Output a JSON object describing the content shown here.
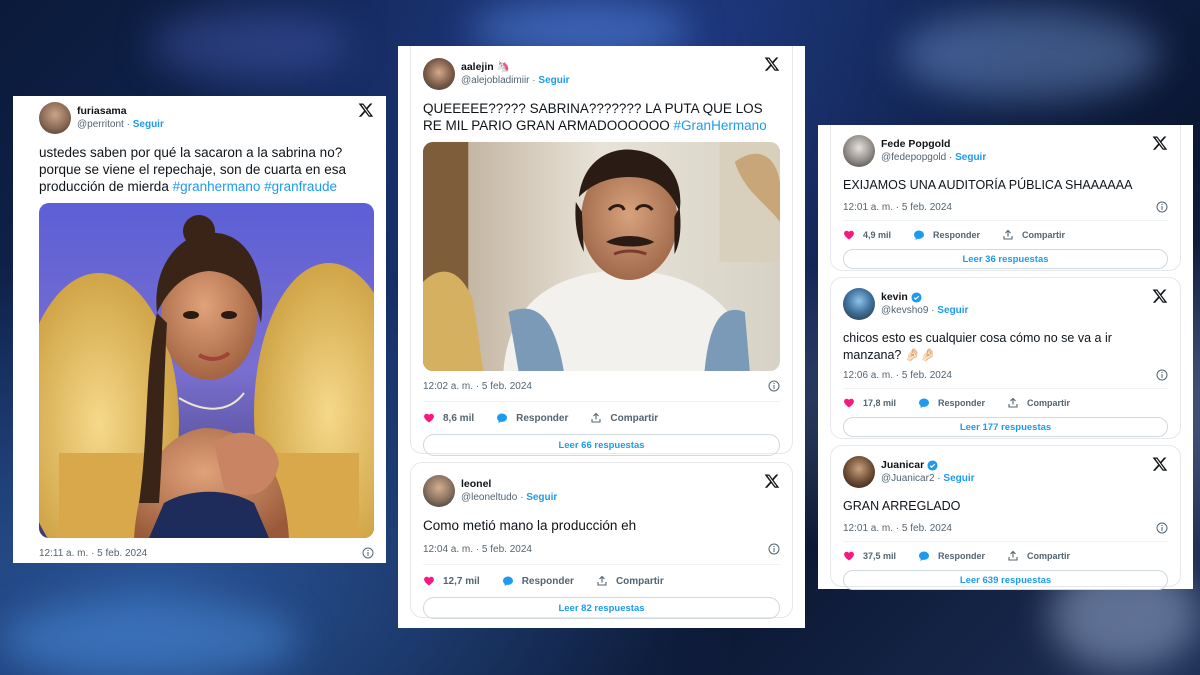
{
  "colors": {
    "accent": "#1d9bf0",
    "text": "#0f1419",
    "muted": "#536471",
    "like": "#f91880"
  },
  "labels": {
    "follow": "Seguir",
    "reply": "Responder",
    "share": "Compartir"
  },
  "tweets": [
    {
      "name": "furiasama",
      "handle": "@perritont",
      "text": "ustedes saben por qué la sacaron a la sabrina no? porque se viene el repechaje, son de cuarta en esa producción de mierda ",
      "hashtags": [
        "#granhermano",
        "#granfraude"
      ],
      "timestamp": "12:11 a. m. · 5 feb. 2024",
      "media": "woman-on-yellow-armchair-photo"
    },
    {
      "name": "aalejin 🦄",
      "handle": "@alejobladimiir",
      "text": "QUEEEEE????? SABRINA??????? LA PUTA QUE LOS RE MIL PARIO GRAN ARMADOOOOOO ",
      "hashtag": "#GranHermano",
      "timestamp": "12:02 a. m. · 5 feb. 2024",
      "likes": "8,6 mil",
      "replies_button": "Leer 66 respuestas",
      "media": "man-crying-meme-photo"
    },
    {
      "name": "leonel",
      "handle": "@leoneltudo",
      "text": "Como metió mano la producción eh",
      "timestamp": "12:04 a. m. · 5 feb. 2024",
      "likes": "12,7 mil",
      "replies_button": "Leer 82 respuestas"
    },
    {
      "name": "Fede Popgold",
      "handle": "@fedepopgold",
      "text": "EXIJAMOS UNA AUDITORÍA PÚBLICA SHAAAAAA",
      "timestamp": "12:01 a. m. · 5 feb. 2024",
      "likes": "4,9 mil",
      "replies_button": "Leer 36 respuestas"
    },
    {
      "name": "kevin",
      "handle": "@kevsho9",
      "verified": true,
      "text": "chicos esto es cualquier cosa cómo no se va a ir manzana? 🤌🏻🤌🏻",
      "timestamp": "12:06 a. m. · 5 feb. 2024",
      "likes": "17,8 mil",
      "replies_button": "Leer 177 respuestas"
    },
    {
      "name": "Juanicar",
      "handle": "@Juanicar2",
      "verified": true,
      "text": "GRAN ARREGLADO",
      "timestamp": "12:01 a. m. · 5 feb. 2024",
      "likes": "37,5 mil",
      "replies_button": "Leer 639 respuestas"
    }
  ]
}
